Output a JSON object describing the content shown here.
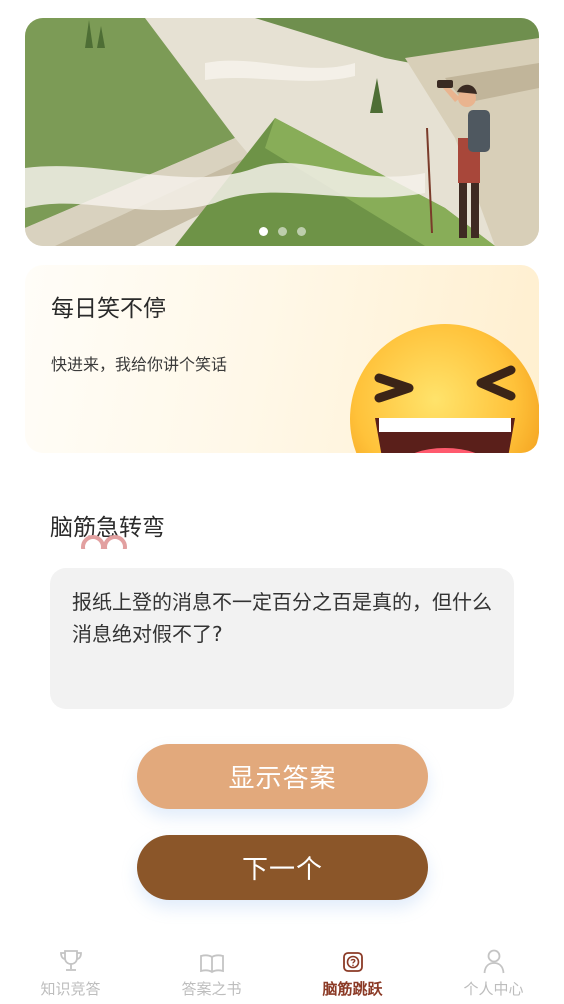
{
  "banner": {
    "slide_count": 3,
    "active_slide": 0
  },
  "joke_card": {
    "title": "每日笑不停",
    "subtitle": "快进来，我给你讲个笑话"
  },
  "riddle": {
    "section_title": "脑筋急转弯",
    "question": "报纸上登的消息不一定百分之百是真的，但什么消息绝对假不了?"
  },
  "buttons": {
    "show_answer": "显示答案",
    "next": "下一个"
  },
  "tabbar": {
    "active_index": 2,
    "tabs": [
      {
        "label": "知识竞答",
        "icon": "trophy-icon"
      },
      {
        "label": "答案之书",
        "icon": "book-icon"
      },
      {
        "label": "脑筋跳跃",
        "icon": "brain-quiz-icon"
      },
      {
        "label": "个人中心",
        "icon": "user-icon"
      }
    ]
  },
  "colors": {
    "show_answer_button": "#e2a97c",
    "next_button": "#8b5629",
    "active_tab": "#8b3a26",
    "inactive_tab": "#bdbdbd"
  }
}
